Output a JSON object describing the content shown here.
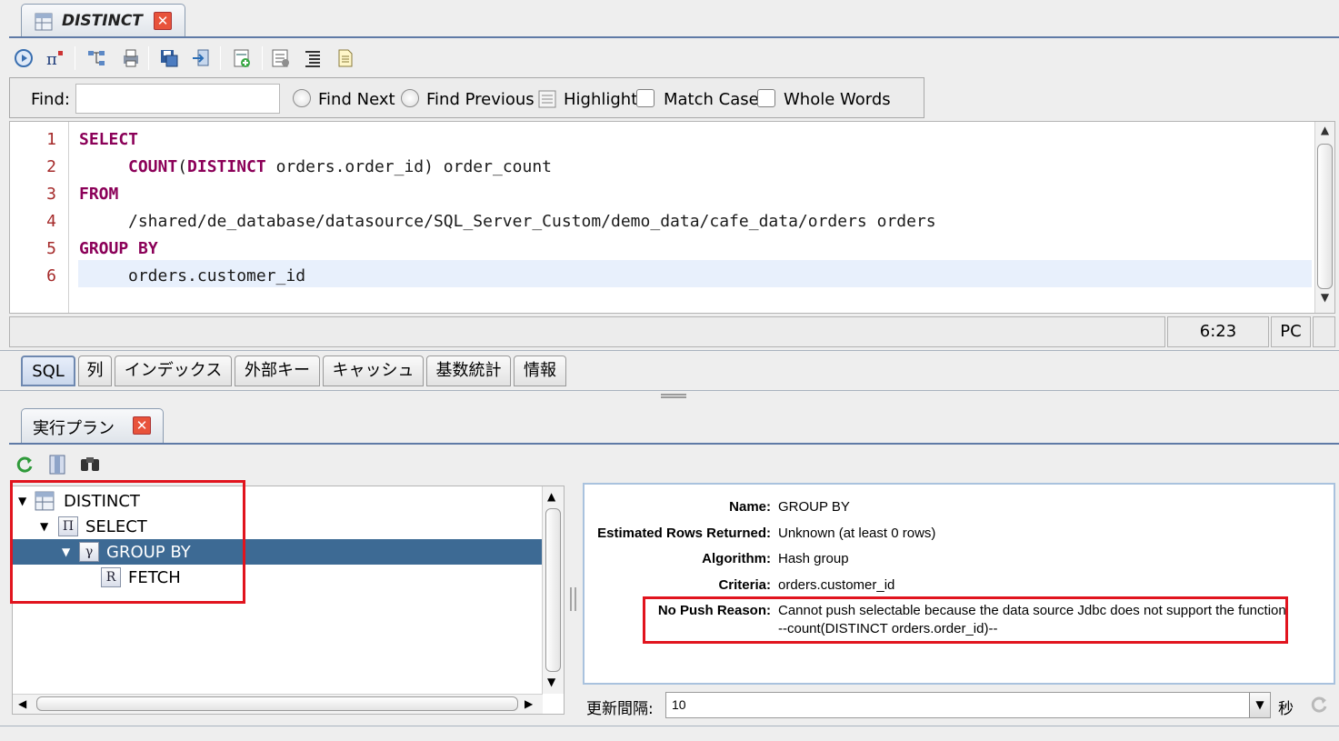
{
  "editor_tab": {
    "title": "DISTINCT",
    "close": "✕"
  },
  "toolbar": {
    "icons": [
      "run-icon",
      "plan-icon",
      "tree-icon",
      "print-icon",
      "save-icon",
      "import-icon",
      "export-icon",
      "new-icon",
      "format-icon",
      "list-icon",
      "document-icon"
    ]
  },
  "find": {
    "label": "Find:",
    "value": "",
    "find_next": "Find Next",
    "find_previous": "Find Previous",
    "highlight": "Highlight",
    "match_case": "Match Case",
    "whole_words": "Whole Words"
  },
  "code": {
    "line_numbers": [
      "1",
      "2",
      "3",
      "4",
      "5",
      "6"
    ],
    "line1": "SELECT",
    "line2_fn": "COUNT",
    "line2_paren": "(",
    "line2_kw": "DISTINCT",
    "line2_rest": " orders.order_id) order_count",
    "line3": "FROM",
    "line4": "/shared/de_database/datasource/SQL_Server_Custom/demo_data/cafe_data/orders orders",
    "line5": "GROUP BY",
    "line6": "orders.customer_id"
  },
  "status": {
    "position": "6:23",
    "mode": "PC"
  },
  "sub_tabs": [
    "SQL",
    "列",
    "インデックス",
    "外部キー",
    "キャッシュ",
    "基数統計",
    "情報"
  ],
  "plan_tab": {
    "title": "実行プラン",
    "close": "✕"
  },
  "plan_toolbar": {
    "icons": [
      "refresh-icon",
      "columns-icon",
      "binoculars-icon"
    ]
  },
  "tree": [
    {
      "label": "DISTINCT",
      "icon": "table-icon",
      "glyph": "▦",
      "level": 0,
      "selected": false
    },
    {
      "label": "SELECT",
      "icon": "project-icon",
      "glyph": "Π",
      "level": 1,
      "selected": false
    },
    {
      "label": "GROUP BY",
      "icon": "gamma-icon",
      "glyph": "γ",
      "level": 2,
      "selected": true
    },
    {
      "label": "FETCH",
      "icon": "relation-icon",
      "glyph": "R",
      "level": 3,
      "selected": false
    }
  ],
  "details": {
    "name_key": "Name:",
    "name_val": "GROUP BY",
    "rows_key": "Estimated Rows Returned:",
    "rows_val": "Unknown (at least 0 rows)",
    "algo_key": "Algorithm:",
    "algo_val": "Hash group",
    "criteria_key": "Criteria:",
    "criteria_val": "orders.customer_id",
    "nopush_key": "No Push Reason:",
    "nopush_val1": "Cannot push selectable because the data source Jdbc does not support the function",
    "nopush_val2": "--count(DISTINCT orders.order_id)--"
  },
  "refresh": {
    "label": "更新間隔:",
    "value": "10",
    "unit": "秒"
  },
  "colors": {
    "highlight_box": "#e1141e",
    "selected_row": "#3d6a94",
    "keyword": "#8b0058",
    "line_number": "#a52a2a"
  }
}
